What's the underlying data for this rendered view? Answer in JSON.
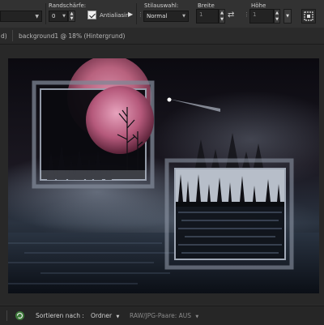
{
  "options": {
    "edge_label": "Randschärfe:",
    "edge_value": "0",
    "antialias_label": "Antialiasir",
    "style_label": "Stilauswahl:",
    "style_value": "Normal",
    "width_label": "Breite",
    "width_value": "1",
    "height_label": "Höhe",
    "height_value": "1",
    "swap_icon": "⇄"
  },
  "tabs": [
    {
      "label": "d)"
    },
    {
      "label": "background1 @ 18% (Hintergrund)"
    }
  ],
  "bottom": {
    "sort_label": "Sortieren nach :",
    "sort_value": "Ordner",
    "raw_label": "RAW/JPG-Paare: AUS"
  },
  "colors": {
    "moon": "#b8627e",
    "water": "#1c2330",
    "accent": "#5a8fd0"
  }
}
